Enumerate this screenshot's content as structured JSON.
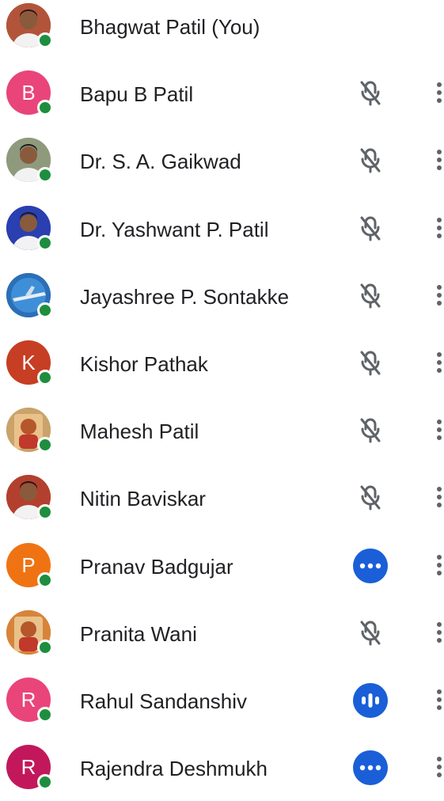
{
  "colors": {
    "presence": "#1e8e3e",
    "badge_blue": "#1a5fd8",
    "icon_gray": "#5f6368",
    "text": "#202124"
  },
  "participants": [
    {
      "name": "Bhagwat Patil (You)",
      "avatar": {
        "type": "photo",
        "hint": "man-portrait",
        "bg": "#b2543a"
      },
      "status": "none"
    },
    {
      "name": "Bapu B Patil",
      "avatar": {
        "type": "initial",
        "letter": "B",
        "bg": "#e9457a"
      },
      "status": "muted-mic-icon"
    },
    {
      "name": "Dr. S. A. Gaikwad",
      "avatar": {
        "type": "photo",
        "hint": "man-portrait",
        "bg": "#8f9a7d"
      },
      "status": "muted-mic-icon"
    },
    {
      "name": "Dr. Yashwant P. Patil",
      "avatar": {
        "type": "photo",
        "hint": "man-blue-background",
        "bg": "#2a3fb0"
      },
      "status": "muted-mic-icon"
    },
    {
      "name": "Jayashree P. Sontakke",
      "avatar": {
        "type": "photo",
        "hint": "airplane-sky",
        "bg": "#2b6fb6"
      },
      "status": "muted-mic-icon"
    },
    {
      "name": "Kishor Pathak",
      "avatar": {
        "type": "initial",
        "letter": "K",
        "bg": "#c63e24"
      },
      "status": "muted-mic-icon"
    },
    {
      "name": "Mahesh Patil",
      "avatar": {
        "type": "photo",
        "hint": "deity-frame",
        "bg": "#c9a36a"
      },
      "status": "muted-mic-icon"
    },
    {
      "name": "Nitin Baviskar",
      "avatar": {
        "type": "photo",
        "hint": "man-portrait",
        "bg": "#b3402e"
      },
      "status": "muted-mic-icon"
    },
    {
      "name": "Pranav Badgujar",
      "avatar": {
        "type": "initial",
        "letter": "P",
        "bg": "#ef7312"
      },
      "status": "more-dots-badge"
    },
    {
      "name": "Pranita Wani",
      "avatar": {
        "type": "photo",
        "hint": "ganesha-idol",
        "bg": "#d7843a"
      },
      "status": "muted-mic-icon"
    },
    {
      "name": "Rahul Sandanshiv",
      "avatar": {
        "type": "initial",
        "letter": "R",
        "bg": "#e9457a"
      },
      "status": "audio-level-badge"
    },
    {
      "name": "Rajendra Deshmukh",
      "avatar": {
        "type": "initial",
        "letter": "R",
        "bg": "#c2185b"
      },
      "status": "more-dots-badge"
    }
  ]
}
